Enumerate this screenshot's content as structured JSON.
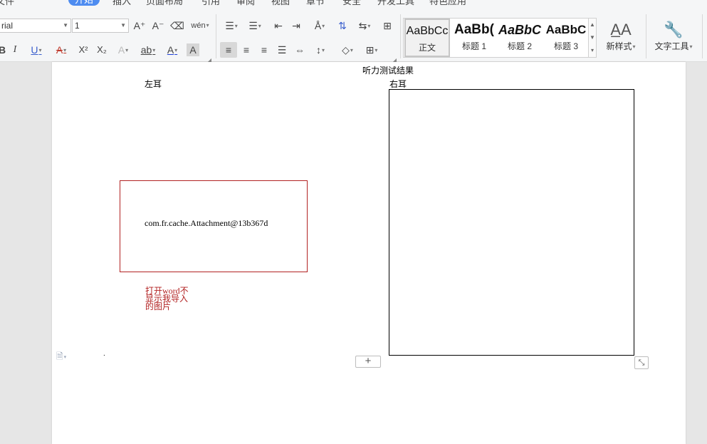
{
  "tabs": [
    "文件",
    "开始",
    "插入",
    "页面布局",
    "引用",
    "审阅",
    "视图",
    "章节",
    "安全",
    "开发工具",
    "特色应用"
  ],
  "active_tab_index": 1,
  "font": {
    "name": "rial",
    "size": "1"
  },
  "toolbar": {
    "grow_font": "A⁺",
    "shrink_font": "A⁻",
    "clear_format": "⌫",
    "phonetic": "wén",
    "bold": "B",
    "italic": "I",
    "underline": "U",
    "strikethrough": "A",
    "superscript": "X²",
    "subscript": "X₂",
    "text_effect": "A",
    "highlight": "ab",
    "font_color": "A",
    "char_shading": "A"
  },
  "styles": [
    {
      "sample": "AaBbCc",
      "label": "正文"
    },
    {
      "sample": "AaBb(",
      "label": "标题 1"
    },
    {
      "sample": "AaBbC",
      "label": "标题 2"
    },
    {
      "sample": "AaBbC",
      "label": "标题 3"
    }
  ],
  "new_style_label": "新样式",
  "text_tools_label": "文字工具",
  "document": {
    "title": "听力测试结果",
    "left_label": "左耳",
    "right_label": "右耳",
    "cache_text": "com.fr.cache.Attachment@13b367d",
    "red_note": "打开word不显示我导入的图片",
    "dot": "."
  },
  "accent_color": "#4e8cf0",
  "note_color": "#b22222"
}
